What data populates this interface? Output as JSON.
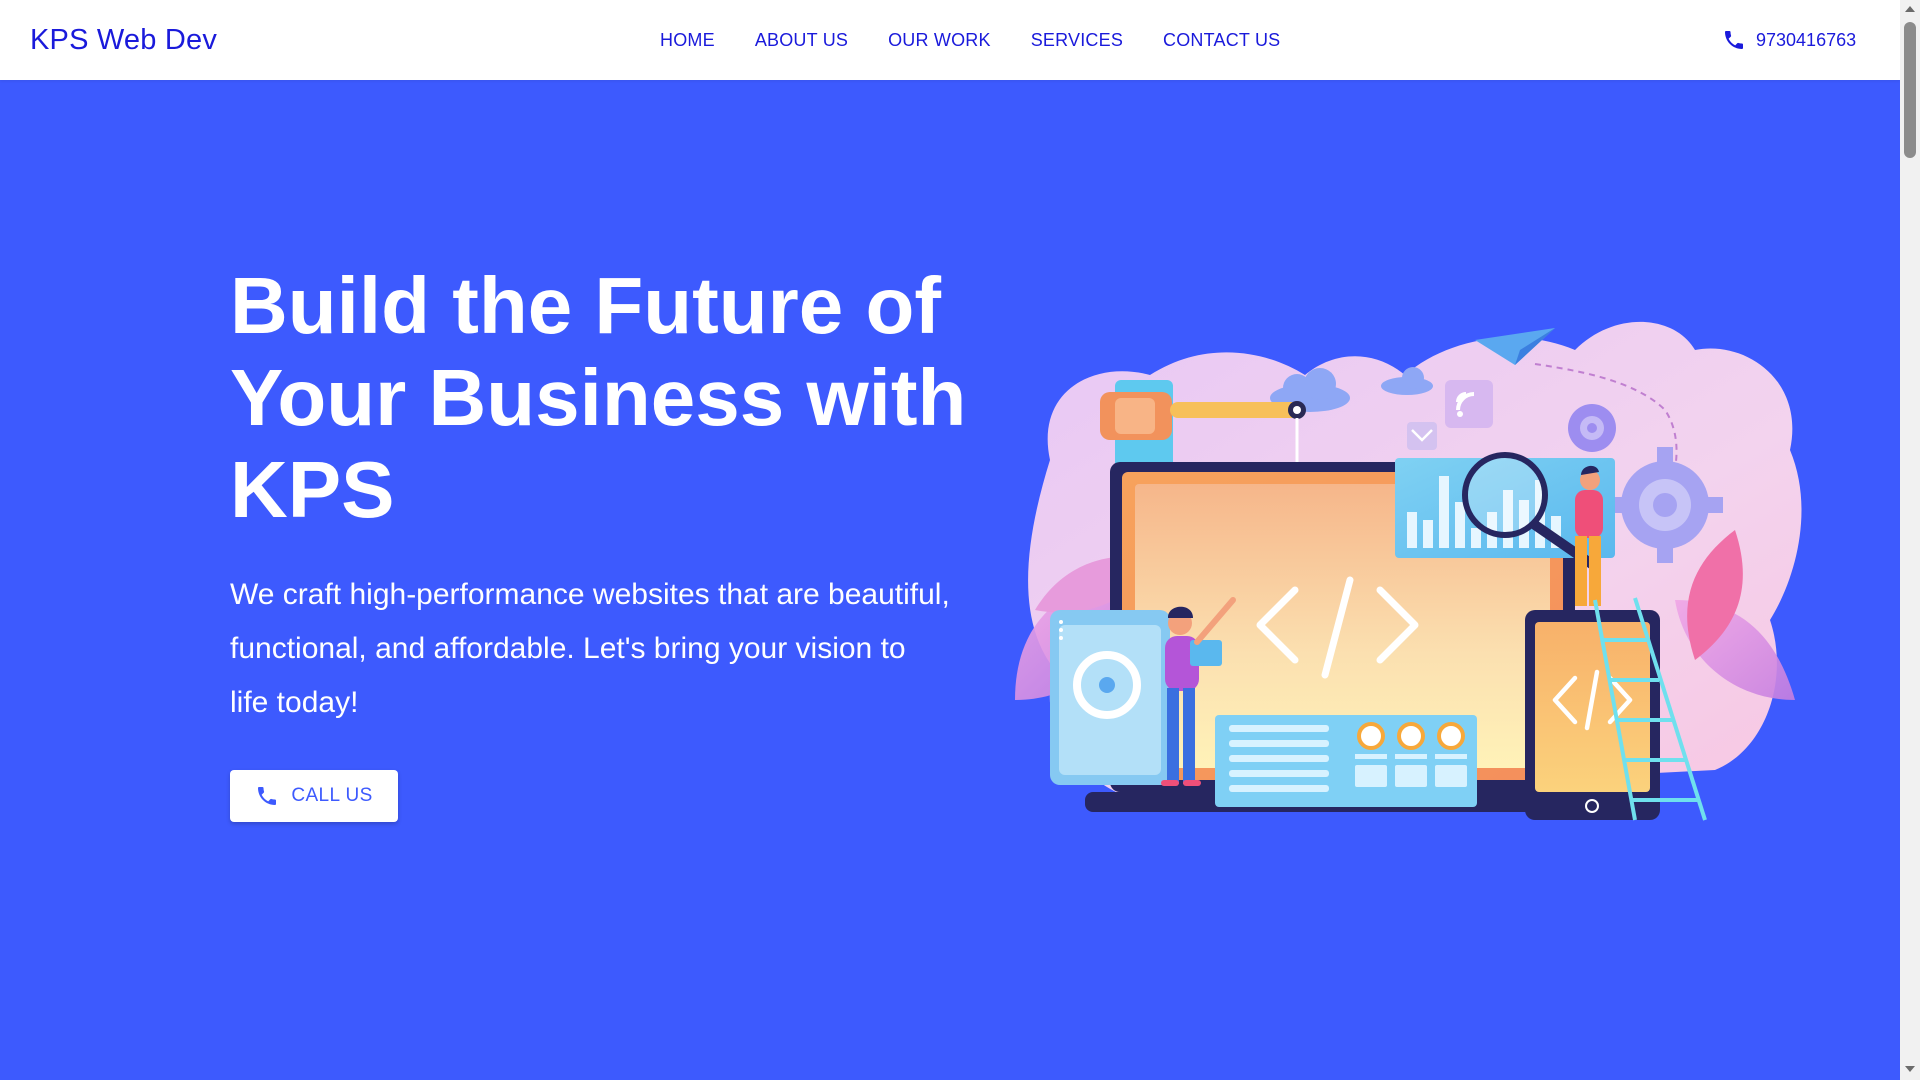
{
  "navbar": {
    "brand": "KPS Web Dev",
    "links": [
      "HOME",
      "ABOUT US",
      "OUR WORK",
      "SERVICES",
      "CONTACT US"
    ],
    "phone": "9730416763",
    "phone_icon": "phone-icon"
  },
  "hero": {
    "title": "Build the Future of Your Business with KPS",
    "description": "We craft high-performance websites that are beautiful, functional, and affordable. Let's bring your vision to life today!",
    "cta_label": "CALL US",
    "cta_icon": "phone-icon"
  },
  "colors": {
    "hero_background": "#3d5afe",
    "navbar_background": "#ffffff",
    "nav_text": "#1a1adb",
    "accent_text": "#3d5afe"
  }
}
